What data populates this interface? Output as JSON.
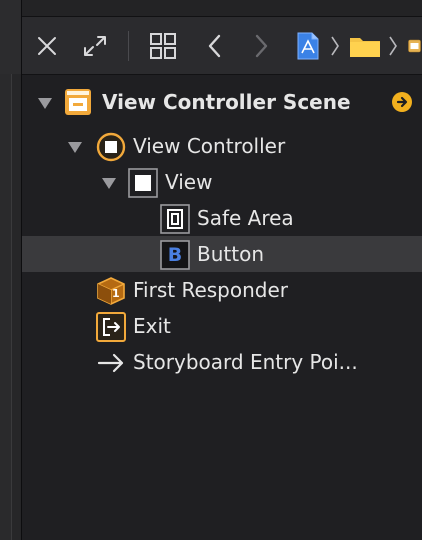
{
  "colors": {
    "accent_orange": "#f2a93b",
    "selection": "#3a3a3d",
    "text": "#e6e6e6",
    "button_blue": "#4a7fe0"
  },
  "toolbar": {
    "icons": [
      "close-icon",
      "expand-icon",
      "grid-icon",
      "back-chevron-icon",
      "forward-chevron-icon",
      "storyboard-file-icon",
      "folder-icon"
    ]
  },
  "outline": {
    "scene": {
      "label": "View Controller Scene"
    },
    "view_controller": {
      "label": "View Controller"
    },
    "view": {
      "label": "View"
    },
    "safe_area": {
      "label": "Safe Area"
    },
    "button": {
      "label": "Button",
      "glyph": "B"
    },
    "first_responder": {
      "label": "First Responder",
      "glyph": "1"
    },
    "exit": {
      "label": "Exit"
    },
    "entry_point": {
      "label": "Storyboard Entry Poi..."
    }
  }
}
